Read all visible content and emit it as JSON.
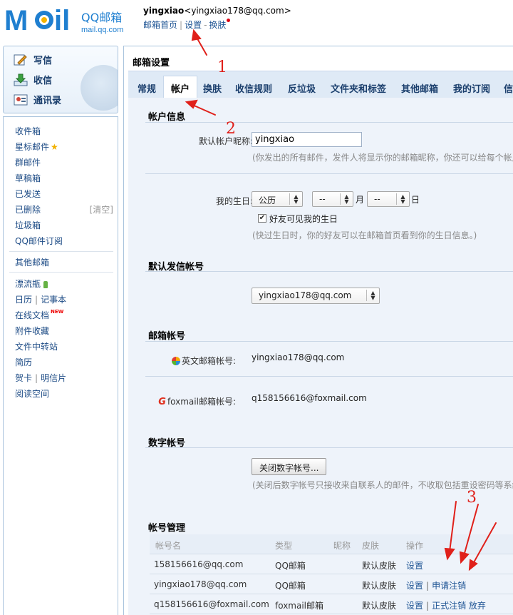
{
  "header": {
    "logo_text": "MOil",
    "brand": "QQ邮箱",
    "brand_domain": "mail.qq.com",
    "user_name": "yingxiao",
    "user_email": "<yingxiao178@qq.com>",
    "links": [
      "邮箱首页",
      "设置",
      "换肤"
    ]
  },
  "left_top": {
    "compose": "写信",
    "inbox": "收信",
    "contacts": "通讯录"
  },
  "nav": {
    "inbox": "收件箱",
    "starred": "星标邮件",
    "group": "群邮件",
    "drafts": "草稿箱",
    "sent": "已发送",
    "deleted": "已删除",
    "clear": "[清空]",
    "spam": "垃圾箱",
    "subscription": "QQ邮件订阅",
    "other_mailbox": "其他邮箱",
    "drift_bottle": "漂流瓶",
    "calendar": "日历",
    "notebook": "记事本",
    "online_docs": "在线文档",
    "new_badge": "NEW",
    "attachments": "附件收藏",
    "transfer": "文件中转站",
    "resume": "简历",
    "greeting_card": "贺卡",
    "postcard": "明信片",
    "reading": "阅读空间"
  },
  "main": {
    "title": "邮箱设置",
    "tabs": [
      "常规",
      "帐户",
      "换肤",
      "收信规则",
      "反垃圾",
      "文件夹和标签",
      "其他邮箱",
      "我的订阅",
      "信"
    ],
    "account_info": {
      "title": "帐户信息",
      "nickname_label": "默认帐户昵称:",
      "nickname_value": "yingxiao",
      "nickname_hint": "(你发出的所有邮件，发件人将显示你的邮箱昵称，你还可以给每个帐户单",
      "birthday_label": "我的生日:",
      "calendar_type": "公历",
      "month_value": "--",
      "month_unit": "月",
      "day_value": "--",
      "day_unit": "日",
      "friends_see_birthday": "好友可见我的生日",
      "birthday_hint": "(快过生日时，你的好友可以在邮箱首页看到你的生日信息。)"
    },
    "default_sender": {
      "title": "默认发信帐号",
      "value": "yingxiao178@qq.com"
    },
    "mail_accounts": {
      "title": "邮箱帐号",
      "english_label": "英文邮箱帐号:",
      "english_value": "yingxiao178@qq.com",
      "foxmail_icon": "G",
      "foxmail_label": "foxmail邮箱帐号:",
      "foxmail_value": "q158156616@foxmail.com"
    },
    "digital_account": {
      "title": "数字帐号",
      "button": "关闭数字帐号...",
      "hint": "(关闭后数字帐号只接收来自联系人的邮件，不收取包括重设密码等系统邮"
    },
    "account_management": {
      "title": "帐号管理",
      "headers": [
        "帐号名",
        "类型",
        "昵称",
        "皮肤",
        "操作"
      ],
      "rows": [
        {
          "name": "158156616@qq.com",
          "type": "QQ邮箱",
          "nickname": "",
          "skin": "默认皮肤",
          "ops": [
            "设置"
          ]
        },
        {
          "name": "yingxiao178@qq.com",
          "type": "QQ邮箱",
          "nickname": "",
          "skin": "默认皮肤",
          "ops": [
            "设置",
            "申请注销"
          ]
        },
        {
          "name": "q158156616@foxmail.com",
          "type": "foxmail邮箱",
          "nickname": "",
          "skin": "默认皮肤",
          "ops": [
            "设置",
            "正式注销",
            "放弃"
          ]
        }
      ]
    }
  },
  "annotations": {
    "n1": "1",
    "n2": "2",
    "n3": "3",
    "color": "#e0201a"
  }
}
